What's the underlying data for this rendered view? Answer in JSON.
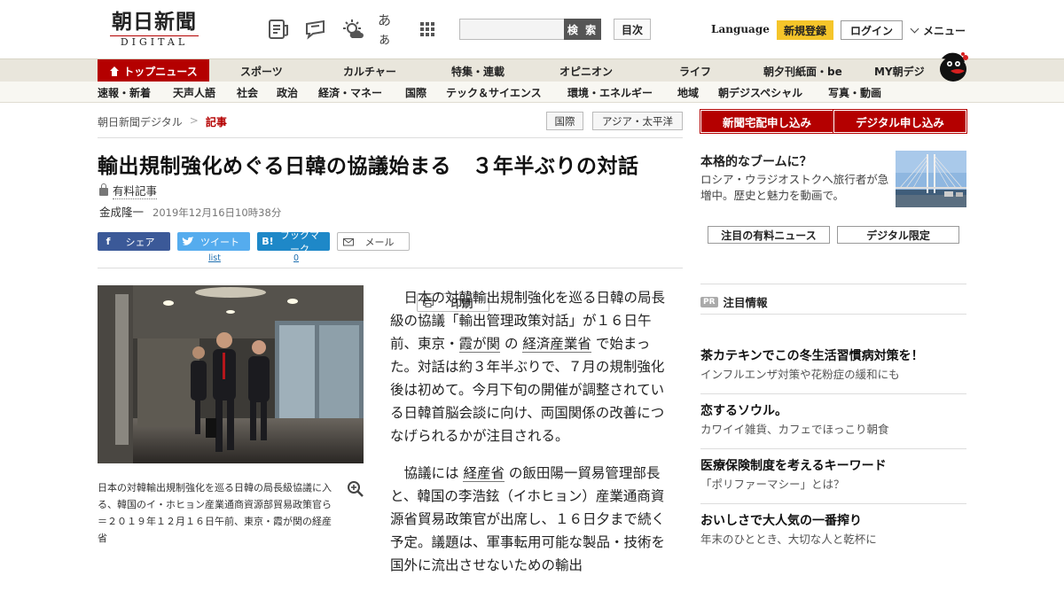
{
  "header": {
    "logo_main": "朝日新聞",
    "logo_sub": "DIGITAL",
    "icons": [
      "newspaper-icon",
      "comment-icon",
      "weather-icon",
      "hiragana-size-icon",
      "app-grid-icon"
    ],
    "aa_label": "あぁ",
    "search_placeholder": "",
    "search_button": "検 索",
    "index_button": "目次",
    "language": "Language",
    "signup": "新規登録",
    "login": "ログイン",
    "menu": "メニュー"
  },
  "nav_primary": [
    "トップニュース",
    "スポーツ",
    "カルチャー",
    "特集・連載",
    "オピニオン",
    "ライフ",
    "朝夕刊紙面・be",
    "MY朝デジ"
  ],
  "nav_secondary": [
    "速報・新着",
    "天声人語",
    "社会",
    "政治",
    "経済・マネー",
    "国際",
    "テック＆サイエンス",
    "環境・エネルギー",
    "地域",
    "朝デジスペシャル",
    "写真・動画"
  ],
  "breadcrumb": {
    "home": "朝日新聞デジタル",
    "sep": ">",
    "current": "記事"
  },
  "tags": [
    "国際",
    "アジア・太平洋"
  ],
  "article": {
    "title": "輸出規制強化めぐる日韓の協議始まる　３年半ぶりの対話",
    "paid_label": "有料記事",
    "author": "金成隆一",
    "date": "2019年12月16日10時38分",
    "share": {
      "facebook": "シェア",
      "twitter": "ツイート",
      "hatena": "ブックマーク",
      "mail": "メール",
      "print": "印刷",
      "twitter_count": "list",
      "hatena_count": "0"
    },
    "caption": "日本の対韓輸出規制強化を巡る日韓の局長級協議に入る、韓国のイ・ホヒョン産業通商資源部貿易政策官ら＝２０１９年１２月１６日午前、東京・霞が関の経産省",
    "p1_a": "日本の対韓輸出規制強化を巡る日韓の局長級の協議「輸出管理政策対話」が１６日午前、東京・",
    "p1_link1": "霞が関",
    "p1_b": "の",
    "p1_link2": "経済産業省",
    "p1_c": "で始まった。対話は約３年半ぶりで、７月の規制強化後は初めて。今月下旬の開催が調整されている日韓首脳会談に向け、両国関係の改善につなげられるかが注目される。",
    "p2_a": "協議には",
    "p2_link": "経産省",
    "p2_b": "の飯田陽一貿易管理部長と、韓国の李浩鉉（イホヒョン）産業通商資源省貿易政策官が出席し、１６日夕まで続く予定。議題は、軍事転用可能な製品・技術を国外に流出させないための輸出"
  },
  "sidebar": {
    "subscribe_paper": "新聞宅配申し込み",
    "subscribe_digital": "デジタル申し込み",
    "feature_title": "本格的なブームに？",
    "feature_desc": "ロシア・ウラジオストクへ旅行者が急増中。歴史と魅力を動画で。",
    "btn_paid_news": "注目の有料ニュース",
    "btn_digital_only": "デジタル限定",
    "pr_badge": "PR",
    "pr_title": "注目情報",
    "pr_items": [
      {
        "title": "茶カテキンでこの冬生活習慣病対策を！",
        "desc": "インフルエンザ対策や花粉症の緩和にも"
      },
      {
        "title": "恋するソウル。",
        "desc": "カワイイ雑貨、カフェでほっこり朝食"
      },
      {
        "title": "医療保険制度を考えるキーワード",
        "desc": "「ポリファーマシー」とは？"
      },
      {
        "title": "おいしさで大人気の一番搾り",
        "desc": "年末のひととき、大切な人と乾杯に"
      }
    ]
  },
  "colors": {
    "brand_red": "#b40000",
    "signup_yellow": "#f5c52a",
    "facebook": "#3b5998",
    "twitter": "#55acee",
    "hatena": "#1e88c8"
  }
}
